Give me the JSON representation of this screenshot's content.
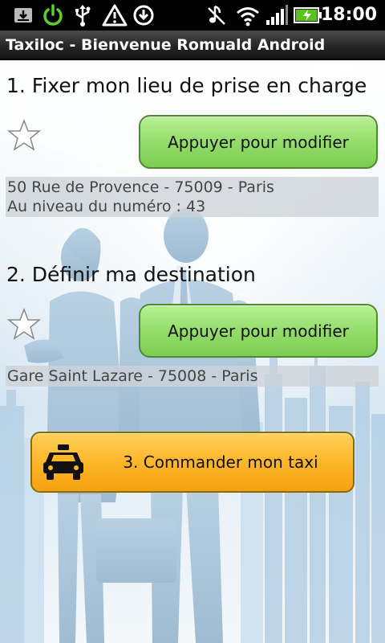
{
  "status_bar": {
    "time": "18:00",
    "icons": [
      "download-icon",
      "power-icon",
      "usb-icon",
      "warning-icon",
      "sync-icon",
      "mute-icon",
      "wifi-icon",
      "signal-icon",
      "battery-charging-icon"
    ]
  },
  "app": {
    "title": "Taxiloc - Bienvenue Romuald Android"
  },
  "pickup": {
    "heading": "1. Fixer mon lieu de prise en charge",
    "button_label": "Appuyer pour modifier",
    "address_line1": "50 Rue de Provence - 75009 - Paris",
    "address_line2": "Au niveau du numéro : 43"
  },
  "destination": {
    "heading": "2. Définir ma destination",
    "button_label": "Appuyer pour modifier",
    "address_line1": "Gare Saint Lazare - 75008 - Paris"
  },
  "order": {
    "button_label": "3. Commander mon taxi"
  },
  "colors": {
    "green_button": "#94dd6b",
    "order_button": "#fdb62a",
    "title_bar": "#262626"
  }
}
